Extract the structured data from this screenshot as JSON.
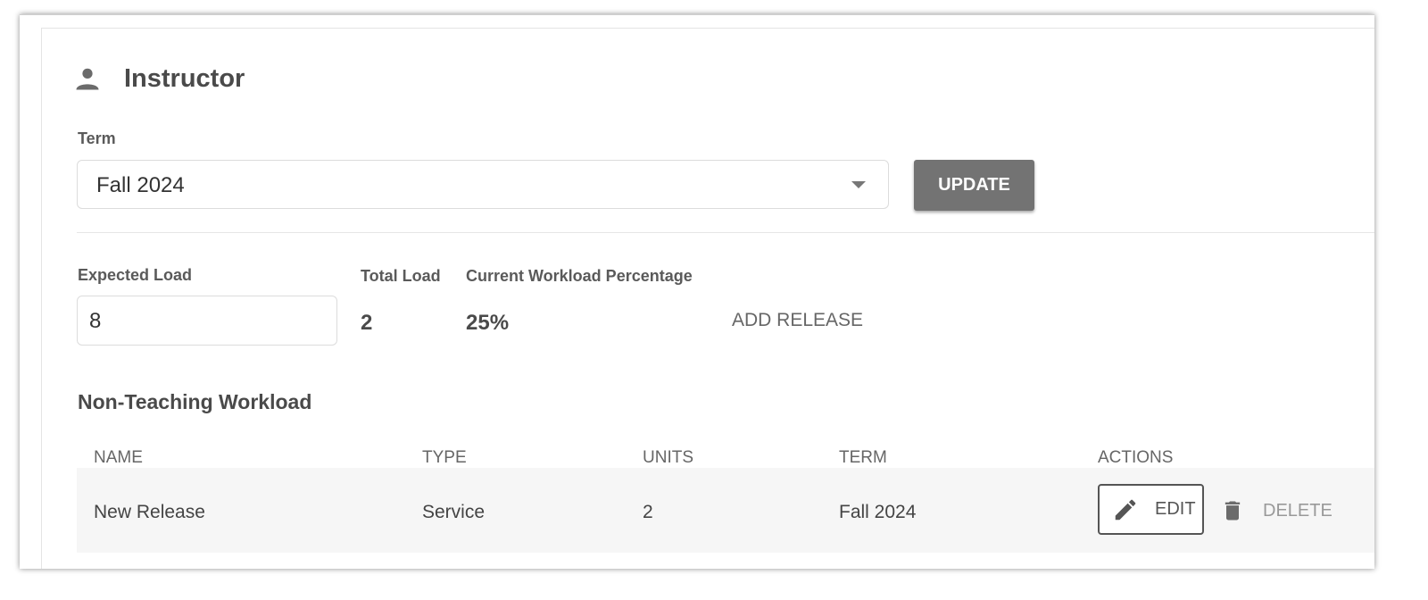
{
  "header": {
    "title": "Instructor",
    "icon": "person-icon"
  },
  "term": {
    "label": "Term",
    "selected": "Fall 2024"
  },
  "update_button": "UPDATE",
  "load": {
    "expected_label": "Expected Load",
    "expected_value": "8",
    "total_label": "Total Load",
    "total_value": "2",
    "percentage_label": "Current Workload Percentage",
    "percentage_value": "25%",
    "add_release": "ADD RELEASE"
  },
  "workload": {
    "title": "Non-Teaching Workload",
    "columns": [
      "NAME",
      "TYPE",
      "UNITS",
      "TERM",
      "ACTIONS"
    ],
    "rows": [
      {
        "name": "New Release",
        "type": "Service",
        "units": "2",
        "term": "Fall 2024"
      }
    ],
    "edit_label": "EDIT",
    "delete_label": "DELETE"
  },
  "colors": {
    "button_bg": "#737373",
    "row_bg": "#f6f6f6",
    "text": "#444444"
  }
}
